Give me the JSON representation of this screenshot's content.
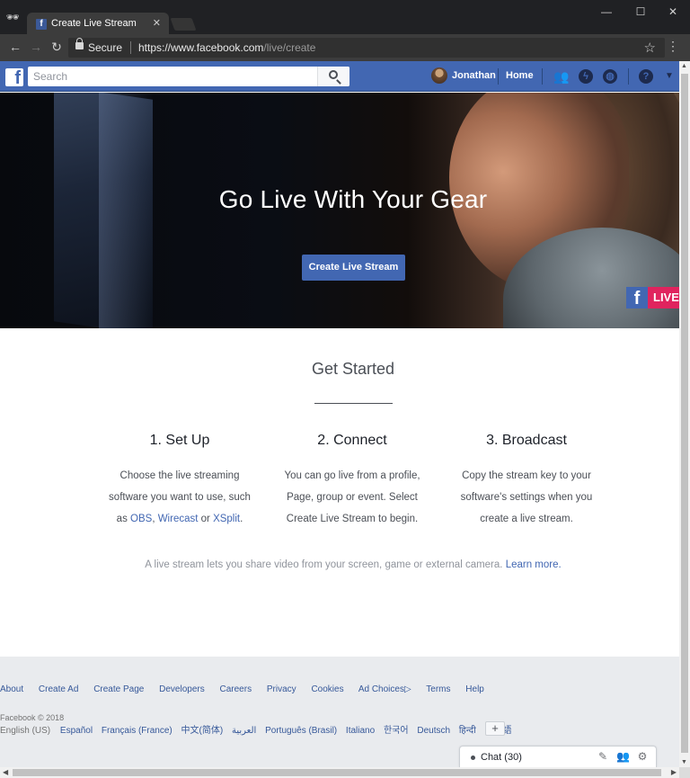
{
  "browser": {
    "tab_title": "Create Live Stream",
    "tab_favicon": "f",
    "secure_label": "Secure",
    "url_host": "https://www.facebook.com",
    "url_path": "/live/create"
  },
  "fb_nav": {
    "logo": "f",
    "search_placeholder": "Search",
    "user_name": "Jonathan",
    "home_label": "Home"
  },
  "hero": {
    "title": "Go Live With Your Gear",
    "cta_label": "Create Live Stream",
    "badge_f": "f",
    "badge_text": "LIVE"
  },
  "get_started": {
    "title": "Get Started",
    "steps": [
      {
        "title": "1. Set Up",
        "line1": "Choose the live streaming",
        "line2": "software you want to use, such",
        "line3_prefix": "as ",
        "link1": "OBS",
        "sep1": ", ",
        "link2": "Wirecast",
        "sep2": " or ",
        "link3": "XSplit",
        "suffix": "."
      },
      {
        "title": "2. Connect",
        "line1": "You can go live from a profile,",
        "line2": "Page, group or event. Select",
        "line3": "Create Live Stream to begin."
      },
      {
        "title": "3. Broadcast",
        "line1": "Copy the stream key to your",
        "line2": "software's settings when you",
        "line3": "create a live stream."
      }
    ],
    "note": "A live stream lets you share video from your screen, game or external camera.",
    "note_link": "Learn more."
  },
  "footer": {
    "links": [
      "About",
      "Create Ad",
      "Create Page",
      "Developers",
      "Careers",
      "Privacy",
      "Cookies",
      "Ad Choices",
      "Terms",
      "Help"
    ],
    "copyright": "Facebook © 2018",
    "current_lang": "English (US)",
    "languages": [
      "Español",
      "Français (France)",
      "中文(简体)",
      "العربية",
      "Português (Brasil)",
      "Italiano",
      "한국어",
      "Deutsch",
      "हिन्दी",
      "日本語"
    ],
    "plus": "+"
  },
  "chat": {
    "label": "Chat (30)"
  }
}
